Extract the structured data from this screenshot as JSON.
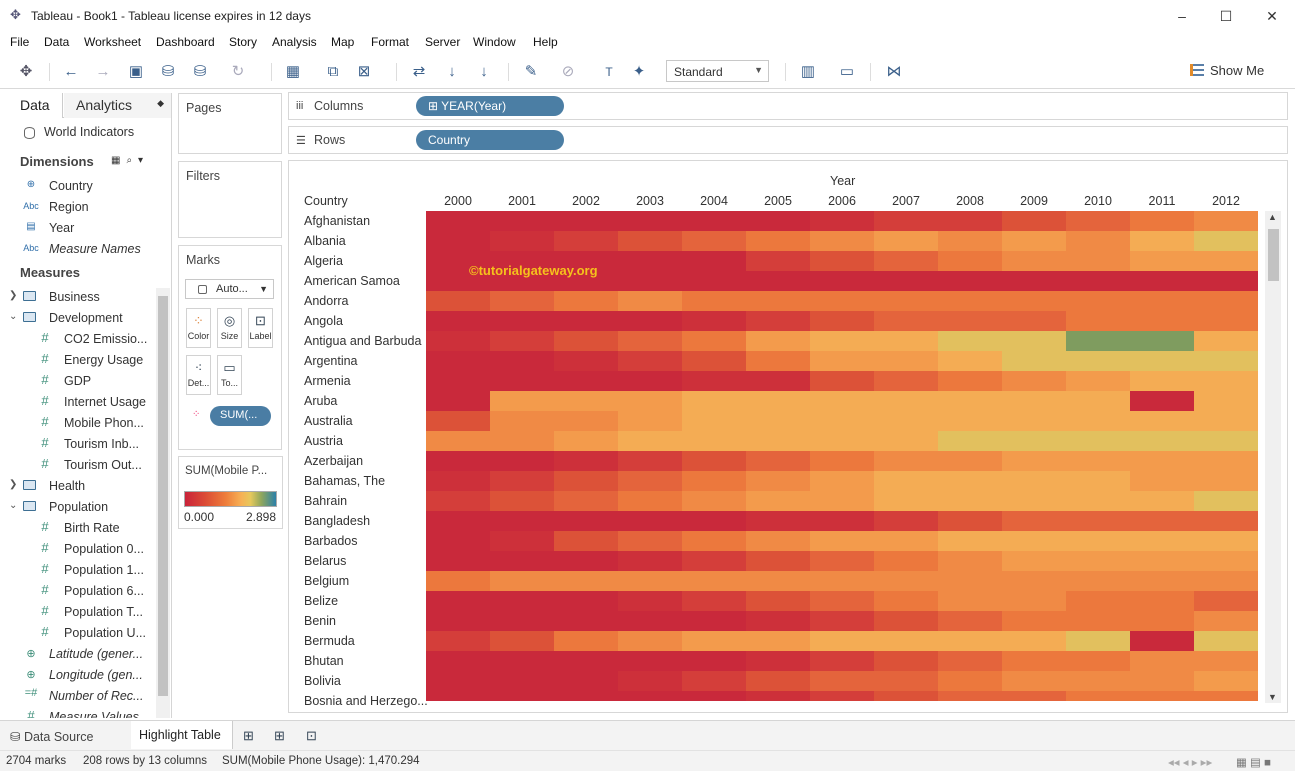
{
  "window": {
    "title": "Tableau - Book1 - Tableau license expires in 12 days",
    "controls": [
      "–",
      "☐",
      "✕"
    ]
  },
  "menu": [
    "File",
    "Data",
    "Worksheet",
    "Dashboard",
    "Story",
    "Analysis",
    "Map",
    "Format",
    "Server",
    "Window",
    "Help"
  ],
  "toolbar": {
    "fit_value": "Standard",
    "show_me_label": "Show Me"
  },
  "data_pane": {
    "tab_data": "Data",
    "tab_analytics": "Analytics",
    "datasource": "World Indicators",
    "dimensions_header": "Dimensions",
    "dimensions": [
      {
        "icon": "globe-icon",
        "glyph": "⊕",
        "label": "Country"
      },
      {
        "icon": "abc-icon",
        "glyph": "Abc",
        "label": "Region"
      },
      {
        "icon": "calendar-icon",
        "glyph": "▤",
        "label": "Year"
      },
      {
        "icon": "abc-icon",
        "glyph": "Abc",
        "label": "Measure Names"
      }
    ],
    "measures_header": "Measures",
    "measures": [
      {
        "type": "folder",
        "label": "Business",
        "expanded": false
      },
      {
        "type": "folder",
        "label": "Development",
        "expanded": true
      },
      {
        "type": "measure",
        "label": "CO2 Emissio..."
      },
      {
        "type": "measure",
        "label": "Energy Usage"
      },
      {
        "type": "measure",
        "label": "GDP"
      },
      {
        "type": "measure",
        "label": "Internet Usage"
      },
      {
        "type": "measure",
        "label": "Mobile Phon..."
      },
      {
        "type": "measure",
        "label": "Tourism Inb..."
      },
      {
        "type": "measure",
        "label": "Tourism Out..."
      },
      {
        "type": "folder",
        "label": "Health",
        "expanded": false
      },
      {
        "type": "folder",
        "label": "Population",
        "expanded": true
      },
      {
        "type": "measure",
        "label": "Birth Rate"
      },
      {
        "type": "measure",
        "label": "Population 0..."
      },
      {
        "type": "measure",
        "label": "Population 1..."
      },
      {
        "type": "measure",
        "label": "Population 6..."
      },
      {
        "type": "measure",
        "label": "Population T..."
      },
      {
        "type": "measure",
        "label": "Population U..."
      },
      {
        "type": "geo",
        "label": "Latitude (gener..."
      },
      {
        "type": "geo",
        "label": "Longitude (gen..."
      },
      {
        "type": "calc",
        "label": "Number of Rec..."
      },
      {
        "type": "measure_italic",
        "label": "Measure Values"
      }
    ]
  },
  "cards": {
    "pages": "Pages",
    "filters": "Filters",
    "marks": "Marks",
    "mark_type": "Auto...",
    "mark_buttons": [
      "Color",
      "Size",
      "Label",
      "Det...",
      "To..."
    ],
    "mark_pill": "SUM(..."
  },
  "legend": {
    "title": "SUM(Mobile P...",
    "min": "0.000",
    "max": "2.898"
  },
  "shelves": {
    "columns_label": "Columns",
    "columns_pill": "YEAR(Year)",
    "rows_label": "Rows",
    "rows_pill": "Country"
  },
  "view": {
    "column_title": "Year",
    "row_title": "Country",
    "watermark": "©tutorialgateway.org",
    "years": [
      "2000",
      "2001",
      "2002",
      "2003",
      "2004",
      "2005",
      "2006",
      "2007",
      "2008",
      "2009",
      "2010",
      "2011",
      "2012"
    ],
    "countries": [
      "Afghanistan",
      "Albania",
      "Algeria",
      "American Samoa",
      "Andorra",
      "Angola",
      "Antigua and Barbuda",
      "Argentina",
      "Armenia",
      "Aruba",
      "Australia",
      "Austria",
      "Azerbaijan",
      "Bahamas, The",
      "Bahrain",
      "Bangladesh",
      "Barbados",
      "Belarus",
      "Belgium",
      "Belize",
      "Benin",
      "Bermuda",
      "Bhutan",
      "Bolivia",
      "Bosnia and Herzego..."
    ],
    "palette": [
      "#c9293b",
      "#cd303a",
      "#d43e3a",
      "#dc5238",
      "#e4643c",
      "#ec783d",
      "#f08a45",
      "#f39b4c",
      "#f4ac54",
      "#e2c05e",
      "#b5b263",
      "#7f9c5f"
    ],
    "levels": [
      [
        0,
        0,
        0,
        0,
        0,
        0,
        1,
        2,
        2,
        3,
        4,
        5,
        6
      ],
      [
        0,
        1,
        2,
        3,
        4,
        5,
        6,
        7,
        6,
        7,
        6,
        8,
        9
      ],
      [
        0,
        0,
        0,
        0,
        0,
        2,
        3,
        4,
        5,
        6,
        6,
        7,
        7
      ],
      [
        0,
        0,
        0,
        0,
        0,
        0,
        0,
        0,
        0,
        0,
        0,
        0,
        0
      ],
      [
        3,
        4,
        5,
        6,
        5,
        5,
        5,
        5,
        5,
        5,
        5,
        5,
        5
      ],
      [
        0,
        0,
        0,
        0,
        1,
        2,
        3,
        4,
        4,
        4,
        5,
        5,
        5
      ],
      [
        1,
        2,
        3,
        4,
        5,
        7,
        8,
        8,
        9,
        9,
        11,
        11,
        8
      ],
      [
        0,
        0,
        1,
        2,
        3,
        5,
        7,
        7,
        8,
        9,
        9,
        9,
        9
      ],
      [
        0,
        0,
        0,
        0,
        1,
        1,
        3,
        4,
        5,
        6,
        7,
        8,
        8
      ],
      [
        0,
        7,
        7,
        7,
        8,
        8,
        8,
        8,
        8,
        8,
        8,
        0,
        8
      ],
      [
        3,
        6,
        6,
        7,
        8,
        8,
        8,
        8,
        8,
        8,
        8,
        8,
        8
      ],
      [
        6,
        6,
        7,
        8,
        8,
        8,
        8,
        8,
        9,
        9,
        9,
        9,
        9
      ],
      [
        0,
        0,
        1,
        2,
        3,
        4,
        5,
        6,
        6,
        7,
        7,
        7,
        7
      ],
      [
        1,
        2,
        3,
        4,
        5,
        6,
        7,
        8,
        8,
        8,
        8,
        7,
        7
      ],
      [
        2,
        3,
        4,
        5,
        6,
        7,
        7,
        8,
        8,
        8,
        8,
        8,
        9
      ],
      [
        0,
        0,
        0,
        0,
        0,
        1,
        1,
        2,
        3,
        4,
        4,
        4,
        4
      ],
      [
        0,
        1,
        3,
        4,
        5,
        6,
        7,
        7,
        8,
        8,
        8,
        8,
        8
      ],
      [
        0,
        0,
        0,
        1,
        2,
        3,
        4,
        5,
        6,
        7,
        7,
        7,
        7
      ],
      [
        5,
        6,
        6,
        6,
        6,
        6,
        6,
        6,
        6,
        6,
        6,
        6,
        6
      ],
      [
        0,
        0,
        0,
        1,
        2,
        3,
        4,
        5,
        6,
        6,
        5,
        5,
        4
      ],
      [
        0,
        0,
        0,
        0,
        0,
        1,
        2,
        3,
        4,
        5,
        5,
        5,
        6
      ],
      [
        2,
        3,
        5,
        6,
        7,
        7,
        8,
        8,
        8,
        8,
        9,
        0,
        9
      ],
      [
        0,
        0,
        0,
        0,
        0,
        1,
        2,
        3,
        4,
        5,
        5,
        6,
        6
      ],
      [
        0,
        0,
        0,
        1,
        2,
        3,
        4,
        4,
        5,
        6,
        6,
        6,
        7
      ],
      [
        0,
        0,
        0,
        0,
        0,
        1,
        2,
        3,
        4,
        4,
        5,
        5,
        5
      ]
    ]
  },
  "sheet_bar": {
    "data_source_tab": "Data Source",
    "sheet_tab": "Highlight Table"
  },
  "status": {
    "marks": "2704 marks",
    "dims": "208 rows by 13 columns",
    "sum": "SUM(Mobile Phone Usage): 1,470.294"
  }
}
